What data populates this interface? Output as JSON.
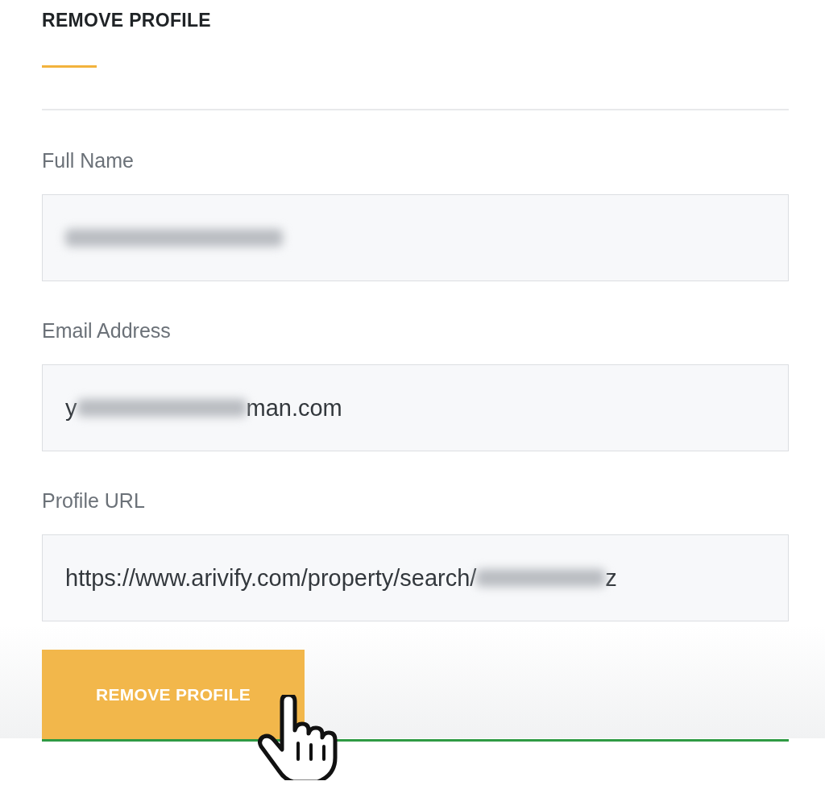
{
  "title": "REMOVE PROFILE",
  "fields": [
    {
      "label": "Full Name",
      "redacted": true
    },
    {
      "label": "Email Address",
      "value_start": "y",
      "redacted": true,
      "value_end": "man.com"
    },
    {
      "label": "Profile URL",
      "value_start": "https://www.arivify.com/property/search/",
      "redacted": true,
      "value_end": "z"
    }
  ],
  "button": {
    "label": "REMOVE PROFILE"
  }
}
